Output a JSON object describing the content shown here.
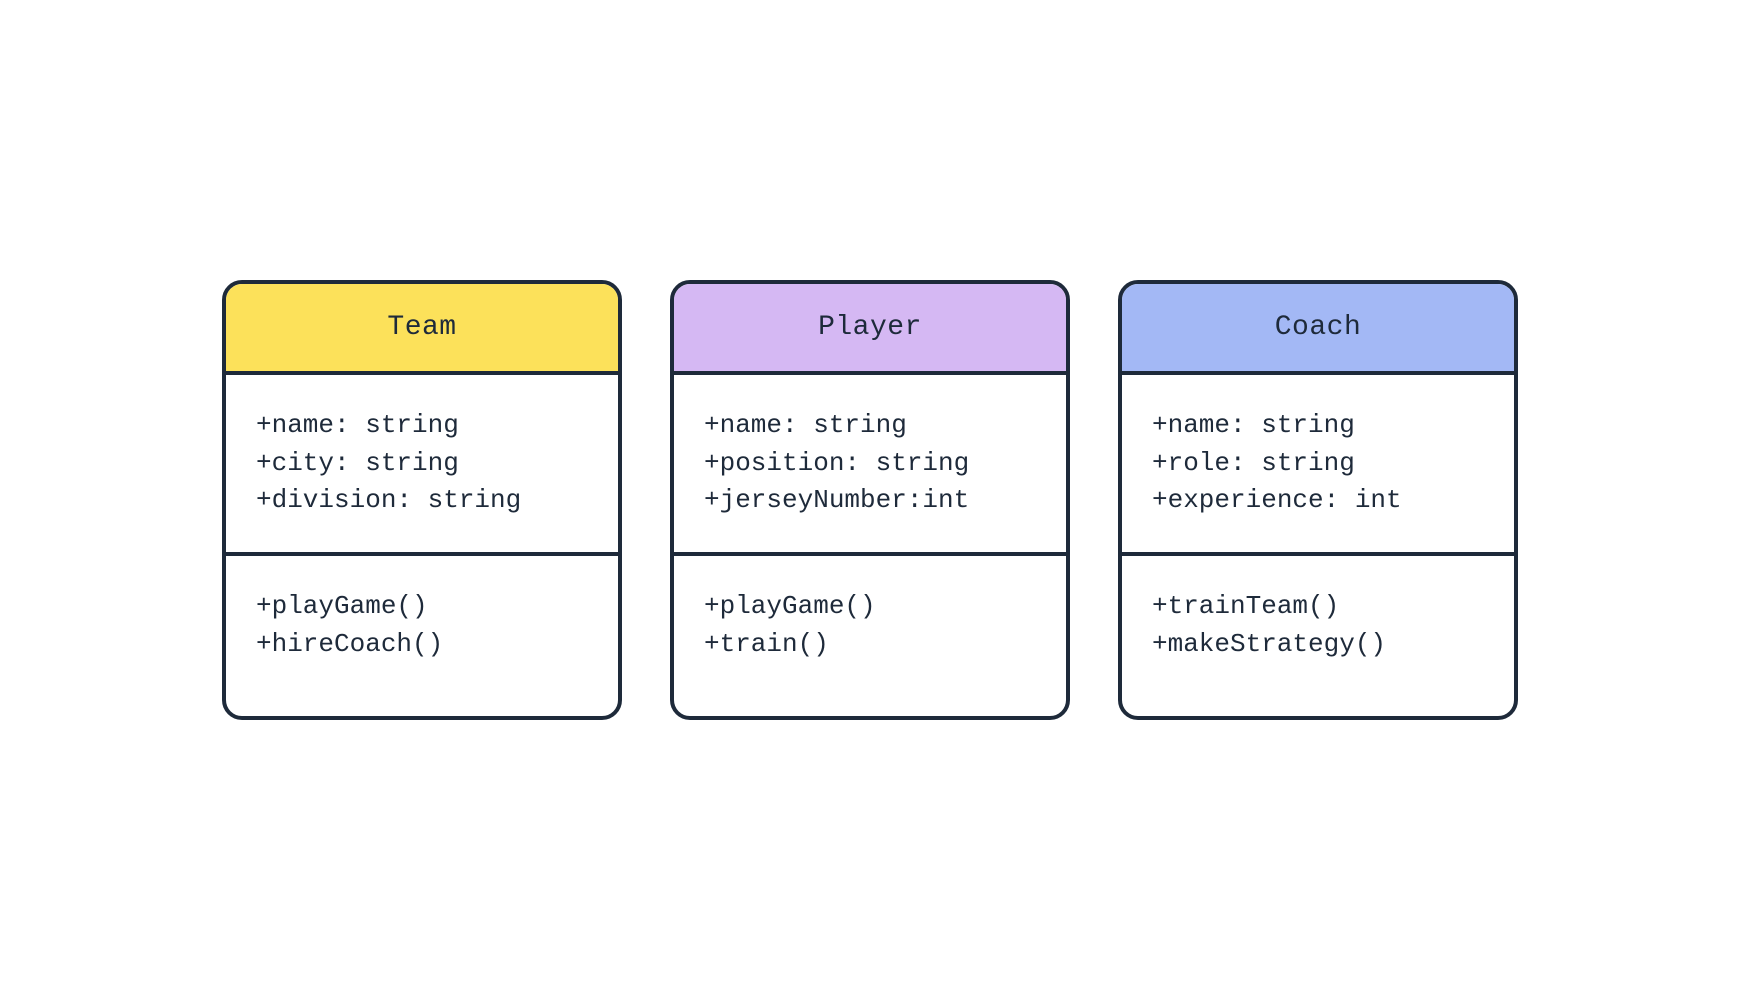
{
  "classes": [
    {
      "name": "Team",
      "headerColor": "yellow",
      "attributes": [
        "+name: string",
        "+city: string",
        "+division: string"
      ],
      "methods": [
        "+playGame()",
        "+hireCoach()"
      ]
    },
    {
      "name": "Player",
      "headerColor": "purple",
      "attributes": [
        "+name: string",
        "+position: string",
        "+jerseyNumber:int"
      ],
      "methods": [
        "+playGame()",
        "+train()"
      ]
    },
    {
      "name": "Coach",
      "headerColor": "blue",
      "attributes": [
        "+name: string",
        "+role: string",
        "+experience: int"
      ],
      "methods": [
        "+trainTeam()",
        "+makeStrategy()"
      ]
    }
  ]
}
